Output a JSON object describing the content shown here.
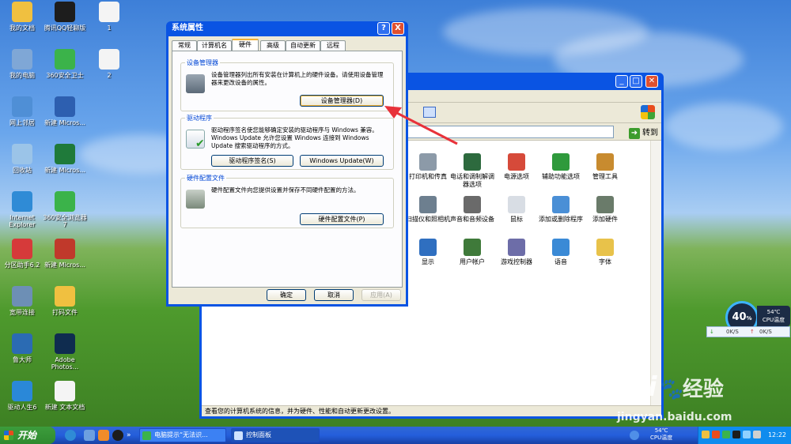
{
  "desktop": {
    "icons": [
      {
        "label": "我的文档",
        "color": "#f0c040"
      },
      {
        "label": "腾讯QQ轻聊版",
        "color": "#1d1d1d"
      },
      {
        "label": "1",
        "color": "#f4f4f4"
      },
      {
        "label": "我的电脑",
        "color": "#7fa7d6"
      },
      {
        "label": "360安全卫士",
        "color": "#3bb34a"
      },
      {
        "label": "2",
        "color": "#f4f4f4"
      },
      {
        "label": "网上邻居",
        "color": "#4f8fd6"
      },
      {
        "label": "新建 Micros...",
        "color": "#2d5fb0"
      },
      {
        "label": "回收站",
        "color": "#9bc4e8"
      },
      {
        "label": "新建 Micros...",
        "color": "#1f7a3a"
      },
      {
        "label": "Internet Explorer",
        "color": "#2f8bd6"
      },
      {
        "label": "360安全浏览器7",
        "color": "#3bb34a"
      },
      {
        "label": "分区助手6.2",
        "color": "#d63a3a"
      },
      {
        "label": "新建 Micros...",
        "color": "#c0392b"
      },
      {
        "label": "宽带连接",
        "color": "#6d8fb5"
      },
      {
        "label": "打码文件",
        "color": "#f0c040"
      },
      {
        "label": "鲁大师",
        "color": "#2b6bb3"
      },
      {
        "label": "Adobe Photos...",
        "color": "#0f2c4f"
      },
      {
        "label": "驱动人生6",
        "color": "#2a88d8"
      },
      {
        "label": "新建 文本文档",
        "color": "#f4f4f4"
      }
    ]
  },
  "explorer": {
    "goto_label": "转到",
    "statusbar": "查看您的计算机系统的信息，并为硬件、性能和自动更新更改设置。",
    "items": [
      {
        "label": "心",
        "color": "#ffffff"
      },
      {
        "label": "打印机和传真",
        "color": "#8c9aa8"
      },
      {
        "label": "电话和调制解调器选项",
        "color": "#2d6a3e"
      },
      {
        "label": "电源选项",
        "color": "#d64a3a"
      },
      {
        "label": "辅助功能选项",
        "color": "#2f9a3c"
      },
      {
        "label": "管理工具",
        "color": "#c88b2f"
      },
      {
        "label": "间",
        "color": "#ffffff"
      },
      {
        "label": "扫描仪和照相机",
        "color": "#6d7f8f"
      },
      {
        "label": "声音和音频设备",
        "color": "#6a6a6a"
      },
      {
        "label": "鼠标",
        "color": "#d8dde4"
      },
      {
        "label": "添加或删除程序",
        "color": "#4a8fd6"
      },
      {
        "label": "添加硬件",
        "color": "#6a7b6a"
      },
      {
        "label": "显示",
        "color": "#2f6fc0"
      },
      {
        "label": "用户帐户",
        "color": "#3f7a3a"
      },
      {
        "label": "游戏控制器",
        "color": "#6d6da8"
      },
      {
        "label": "语音",
        "color": "#3a8ad6"
      },
      {
        "label": "字体",
        "color": "#e8c24a"
      }
    ]
  },
  "dialog": {
    "title": "系统属性",
    "help": "?",
    "close": "X",
    "tabs": [
      "常规",
      "计算机名",
      "硬件",
      "高级",
      "自动更新",
      "远程"
    ],
    "groups": [
      {
        "title": "设备管理器",
        "text": "设备管理器列出所有安装在计算机上的硬件设备。请使用设备管理器来更改设备的属性。",
        "buttons": [
          "设备管理器(D)"
        ]
      },
      {
        "title": "驱动程序",
        "text": "驱动程序签名使您能够确定安装的驱动程序与 Windows 兼容。Windows Update 允许您设置 Windows 连接到 Windows Update 搜索驱动程序的方式。",
        "buttons": [
          "驱动程序签名(S)",
          "Windows Update(W)"
        ]
      },
      {
        "title": "硬件配置文件",
        "text": "硬件配置文件向您提供设置并保存不同硬件配置的方法。",
        "buttons": [
          "硬件配置文件(P)"
        ]
      }
    ],
    "ok": "确定",
    "cancel": "取消",
    "apply": "应用(A)"
  },
  "taskbar": {
    "start": "开始",
    "tasks": [
      "电脑提示“无法识...",
      "控制面板"
    ],
    "cpu_temp": "54℃",
    "cpu_temp_label": "CPU温度",
    "clock": "12:22"
  },
  "widget": {
    "percent": "40",
    "percent_unit": "%",
    "temp": "54℃",
    "temp_label": "CPU温度",
    "down": "0K/S",
    "up": "0K/S"
  },
  "watermark": {
    "brand": "Bai",
    "brand2": "经验",
    "url": "jingyan.baidu.com"
  }
}
